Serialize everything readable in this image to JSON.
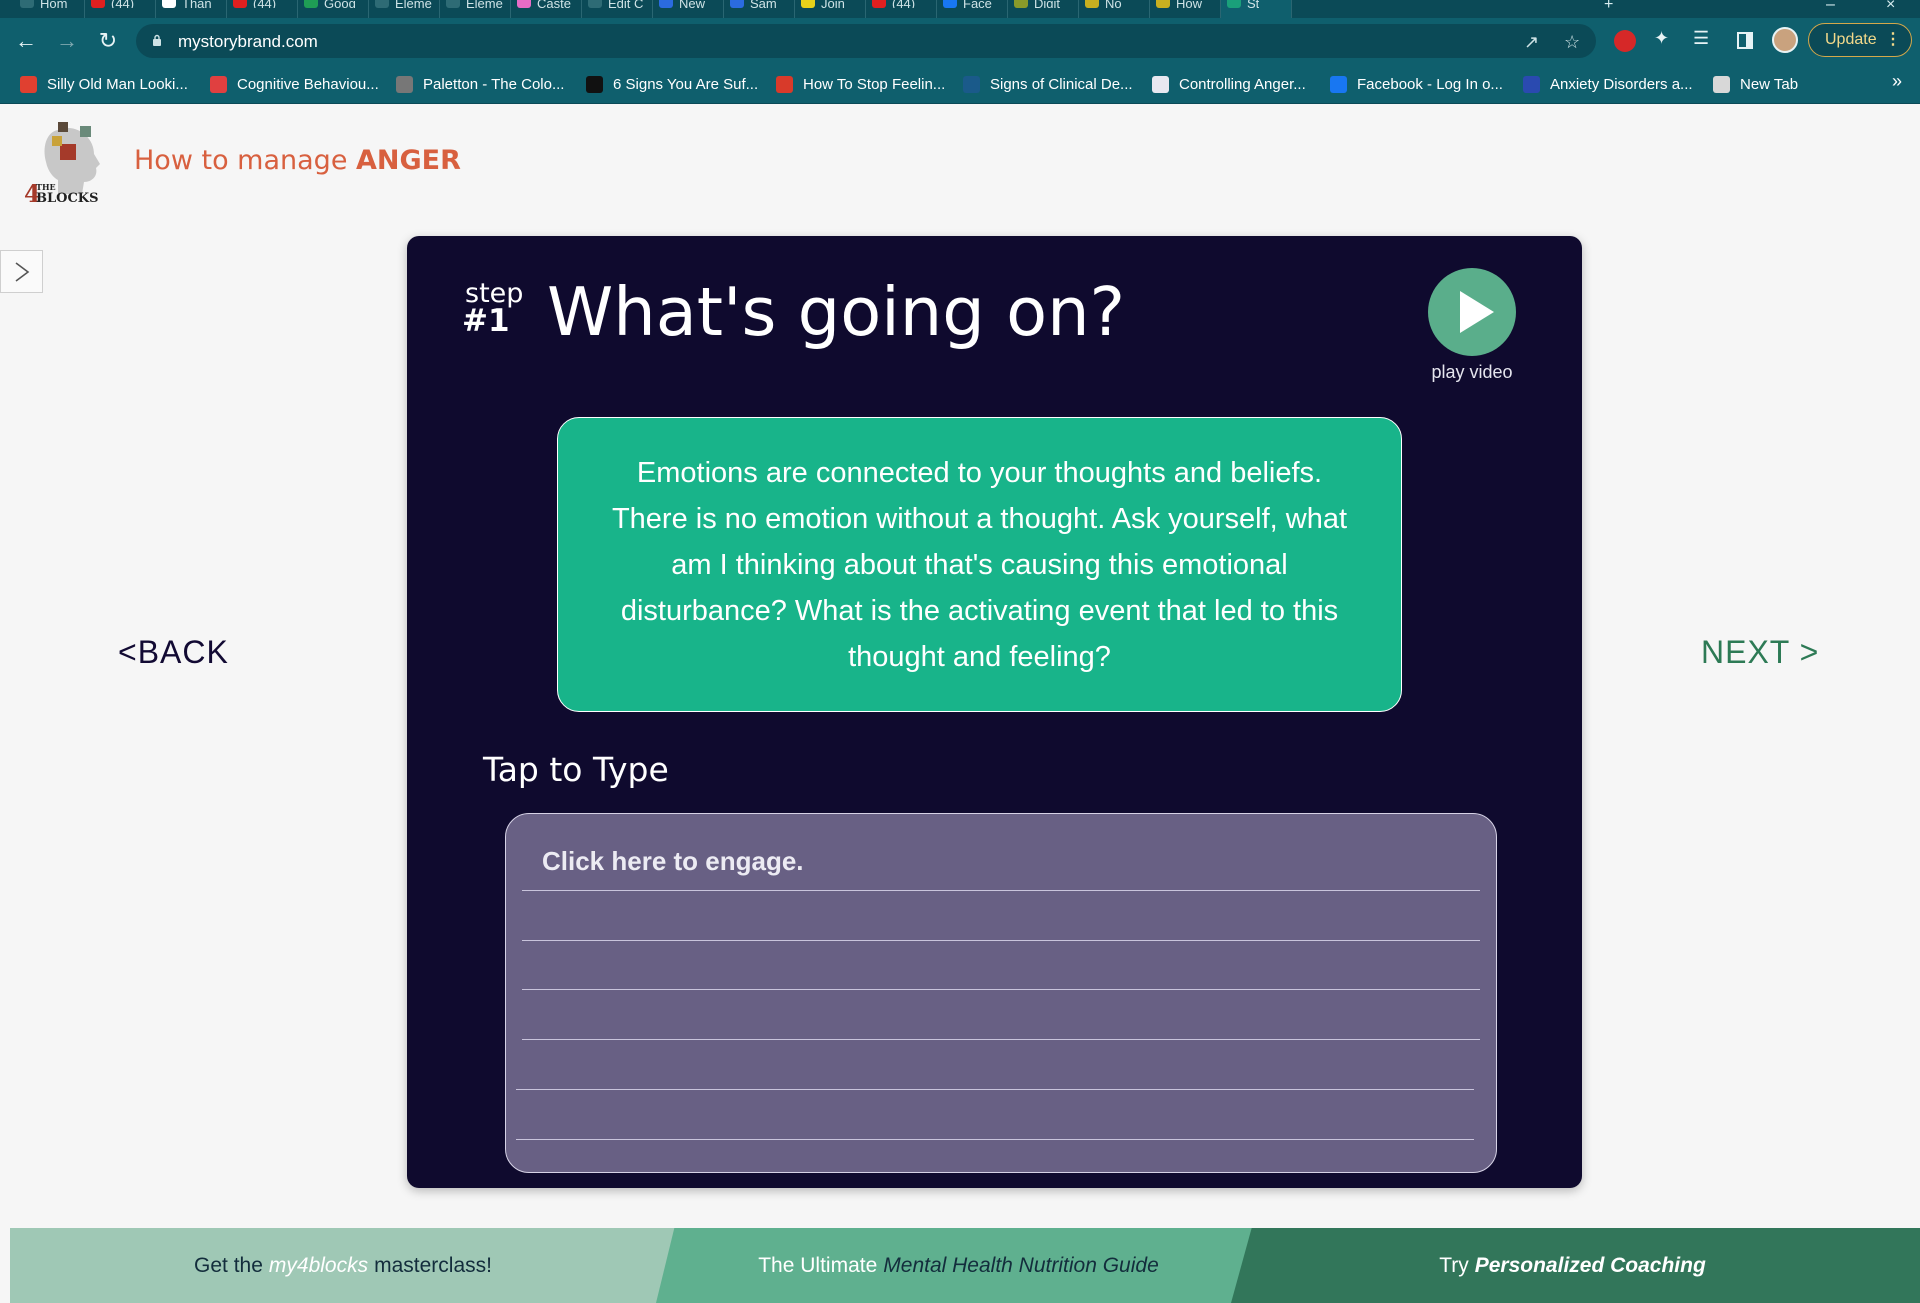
{
  "browser": {
    "tabs": [
      {
        "label": "Hom",
        "color": "#2e6b75"
      },
      {
        "label": "(44)",
        "color": "#e02020"
      },
      {
        "label": "Than",
        "color": "#ffffff"
      },
      {
        "label": "(44)",
        "color": "#e02020"
      },
      {
        "label": "Goog",
        "color": "#1f9d55"
      },
      {
        "label": "Eleme",
        "color": "#2e6b75"
      },
      {
        "label": "Eleme",
        "color": "#2e6b75"
      },
      {
        "label": "Caste",
        "color": "#e86cc6"
      },
      {
        "label": "Edit C",
        "color": "#2e6b75"
      },
      {
        "label": "New",
        "color": "#2b6be0"
      },
      {
        "label": "Sam",
        "color": "#2b6be0"
      },
      {
        "label": "Join",
        "color": "#e8d21a"
      },
      {
        "label": "(44)",
        "color": "#e02020"
      },
      {
        "label": "Face",
        "color": "#1877f2"
      },
      {
        "label": "Digit",
        "color": "#8a9a2a"
      },
      {
        "label": "No",
        "color": "#c8b020"
      },
      {
        "label": "How",
        "color": "#c8b020"
      },
      {
        "label": "St",
        "color": "#1aa07a"
      }
    ],
    "url": "mystorybrand.com",
    "update_label": "Update",
    "bookmarks": [
      {
        "label": "Silly Old Man Looki...",
        "color": "#e04030"
      },
      {
        "label": "Cognitive Behaviou...",
        "color": "#e04040"
      },
      {
        "label": "Paletton - The Colo...",
        "color": "#777777"
      },
      {
        "label": "6 Signs You Are Suf...",
        "color": "#111111"
      },
      {
        "label": "How To Stop Feelin...",
        "color": "#d83a2a"
      },
      {
        "label": "Signs of Clinical De...",
        "color": "#1a5a8a"
      },
      {
        "label": "Controlling Anger...",
        "color": "#e8e8f0"
      },
      {
        "label": "Facebook - Log In o...",
        "color": "#1877f2"
      },
      {
        "label": "Anxiety Disorders a...",
        "color": "#2a4ab0"
      },
      {
        "label": "New Tab",
        "color": "#d8d8d8"
      }
    ]
  },
  "site": {
    "title_prefix": "How to manage ",
    "title_emphasis": "ANGER",
    "logo_text_small": "THE",
    "logo_text_number": "4",
    "logo_text_word": "BLOCKS"
  },
  "nav": {
    "back_label": "<BACK",
    "next_label": "NEXT >"
  },
  "step": {
    "word": "step",
    "number": "#1",
    "title": "What's going on?",
    "play_label": "play video",
    "prompt": "Emotions are connected to your thoughts and beliefs. There is no emotion without a thought. Ask yourself, what am I thinking about that's causing this emotional disturbance? What is the activating event that led to this thought and feeling?",
    "tap_label": "Tap to Type",
    "input_placeholder": "Click here to engage."
  },
  "footer": {
    "banner1": {
      "before": "Get the",
      "emphasis": "my4blocks",
      "after": "masterclass!"
    },
    "banner2": {
      "before": "The Ultimate",
      "emphasis": "Mental Health Nutrition Guide",
      "after": ""
    },
    "banner3": {
      "before": "Try",
      "emphasis": "Personalized Coaching",
      "after": ""
    }
  },
  "colors": {
    "accent_title": "#d8603f",
    "card_bg": "#0f0a2e",
    "prompt_bg": "#18b48a",
    "input_bg": "#686084",
    "play_bg": "#5aae8b",
    "browser_chrome": "#0f5f6d"
  }
}
